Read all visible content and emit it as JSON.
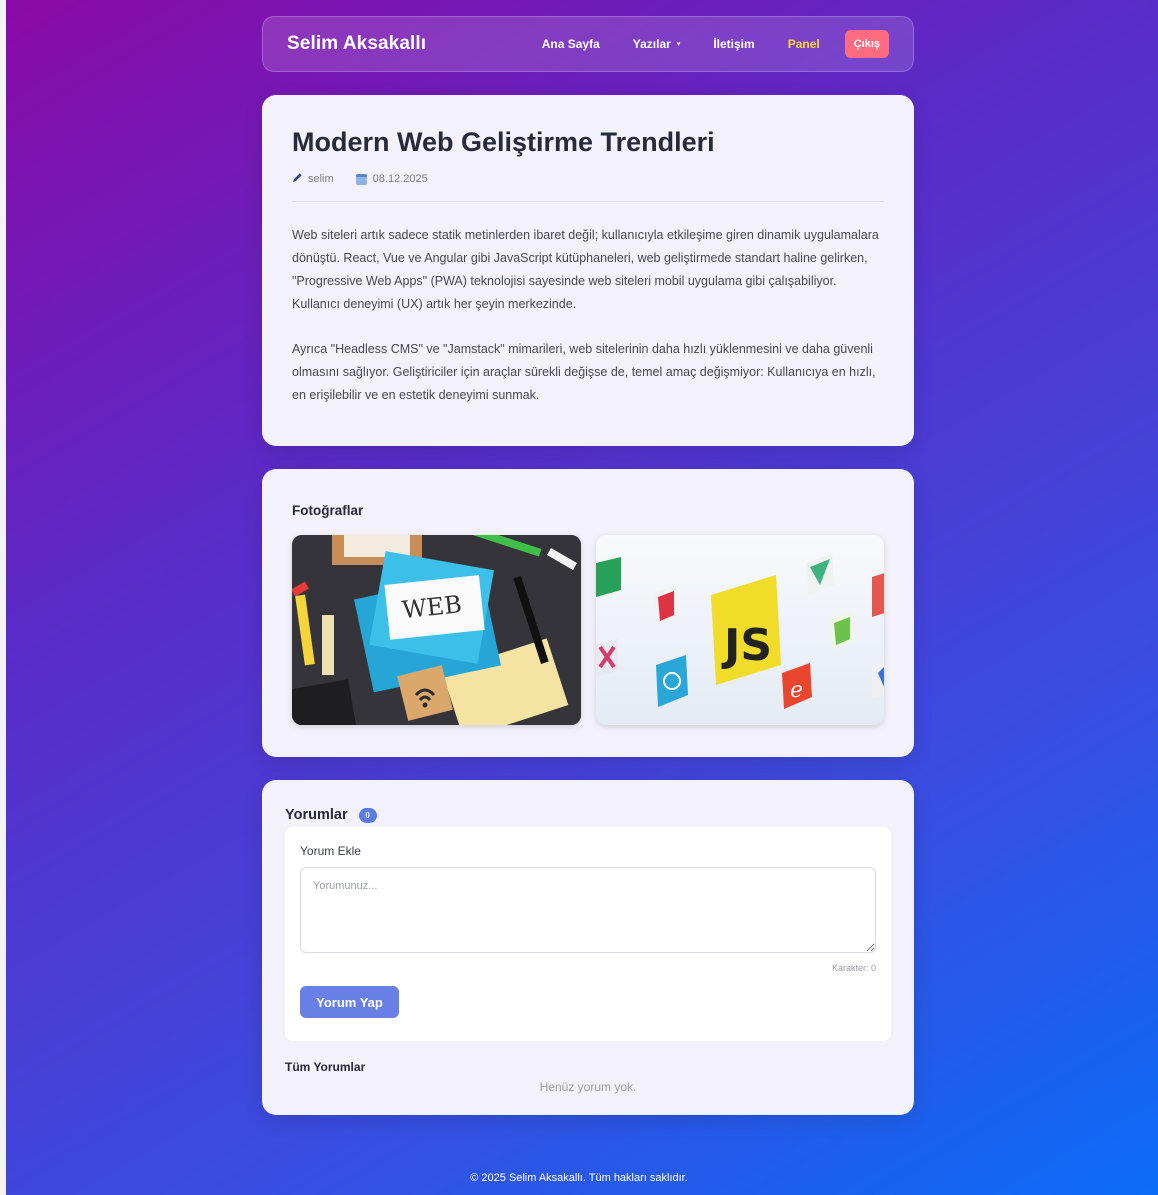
{
  "navbar": {
    "brand": "Selim Aksakallı",
    "links": [
      "Ana Sayfa",
      "Yazılar",
      "İletişim",
      "Panel"
    ],
    "caret": "▾",
    "logout": "Çıkış"
  },
  "article": {
    "title": "Modern Web Geliştirme Trendleri",
    "author": "selim",
    "date": "08.12.2025",
    "paragraphs": [
      "Web siteleri artık sadece statik metinlerden ibaret değil; kullanıcıyla etkileşime giren dinamik uygulamalara dönüştü. React, Vue ve Angular gibi JavaScript kütüphaneleri, web geliştirmede standart haline gelirken, \"Progressive Web Apps\" (PWA) teknolojisi sayesinde web siteleri mobil uygulama gibi çalışabiliyor. Kullanıcı deneyimi (UX) artık her şeyin merkezinde.",
      "Ayrıca \"Headless CMS\" ve \"Jamstack\" mimarileri, web sitelerinin daha hızlı yüklenmesini ve daha güvenli olmasını sağlıyor. Geliştiriciler için araçlar sürekli değişse de, temel amaç değişmiyor: Kullanıcıya en hızlı, en erişilebilir ve en estetik deneyimi sunmak."
    ]
  },
  "photos": {
    "heading": "Fotoğraflar",
    "photo1_text": "WEB",
    "photo2_text": "JS"
  },
  "comments": {
    "heading": "Yorumlar",
    "count": "0",
    "form_label": "Yorum Ekle",
    "placeholder": "Yorumunuz...",
    "char_count": "Karakter: 0",
    "submit": "Yorum Yap",
    "all_heading": "Tüm Yorumlar",
    "empty": "Henüz yorum yok."
  },
  "footer": "© 2025 Selim Aksakallı. Tüm hakları saklıdır.",
  "colors": {
    "accent": "#6880e6",
    "logout": "#ff6b81",
    "panel": "#ffd43b"
  }
}
